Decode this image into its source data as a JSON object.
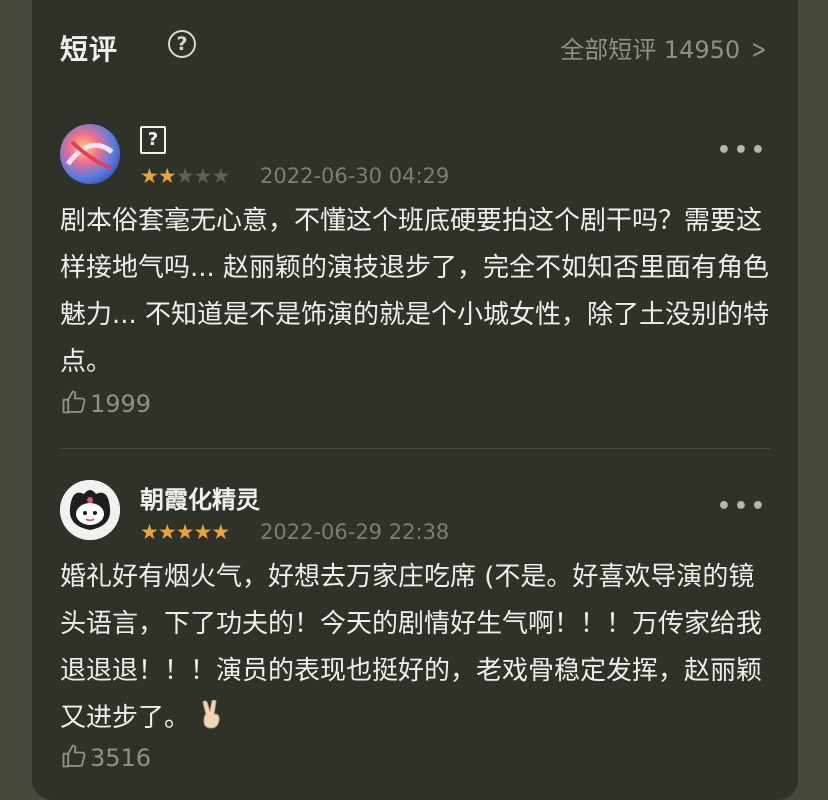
{
  "header": {
    "title": "短评",
    "help_icon": "question-circle-icon",
    "all_link": "全部短评 14950",
    "chevron_icon": "chevron-right-icon"
  },
  "reviews": [
    {
      "username": "?",
      "rating": 2,
      "rating_max": 5,
      "date": "2022-06-30 04:29",
      "more_label": "•••",
      "text": "剧本俗套毫无心意，不懂这个班底硬要拍这个剧干吗？需要这样接地气吗... 赵丽颖的演技退步了，完全不如知否里面有角色魅力... 不知道是不是饰演的就是个小城女性，除了土没别的特点。",
      "likes": "1999",
      "like_icon": "thumbs-up-icon"
    },
    {
      "username": "朝霞化精灵",
      "rating": 5,
      "rating_max": 5,
      "date": "2022-06-29 22:38",
      "more_label": "•••",
      "text": "婚礼好有烟火气，好想去万家庄吃席 (不是。好喜欢导演的镜头语言，下了功夫的！今天的剧情好生气啊！！！万传家给我退退退！！！演员的表现也挺好的，老戏骨稳定发挥，赵丽颖又进步了。",
      "emoji": "victory-hand-emoji",
      "likes": "3516",
      "like_icon": "thumbs-up-icon"
    }
  ],
  "colors": {
    "background": "#46483b",
    "card": "#2f3229",
    "star_on": "#e8a33b",
    "star_off": "#5d5f56",
    "muted_text": "#8f9088"
  }
}
